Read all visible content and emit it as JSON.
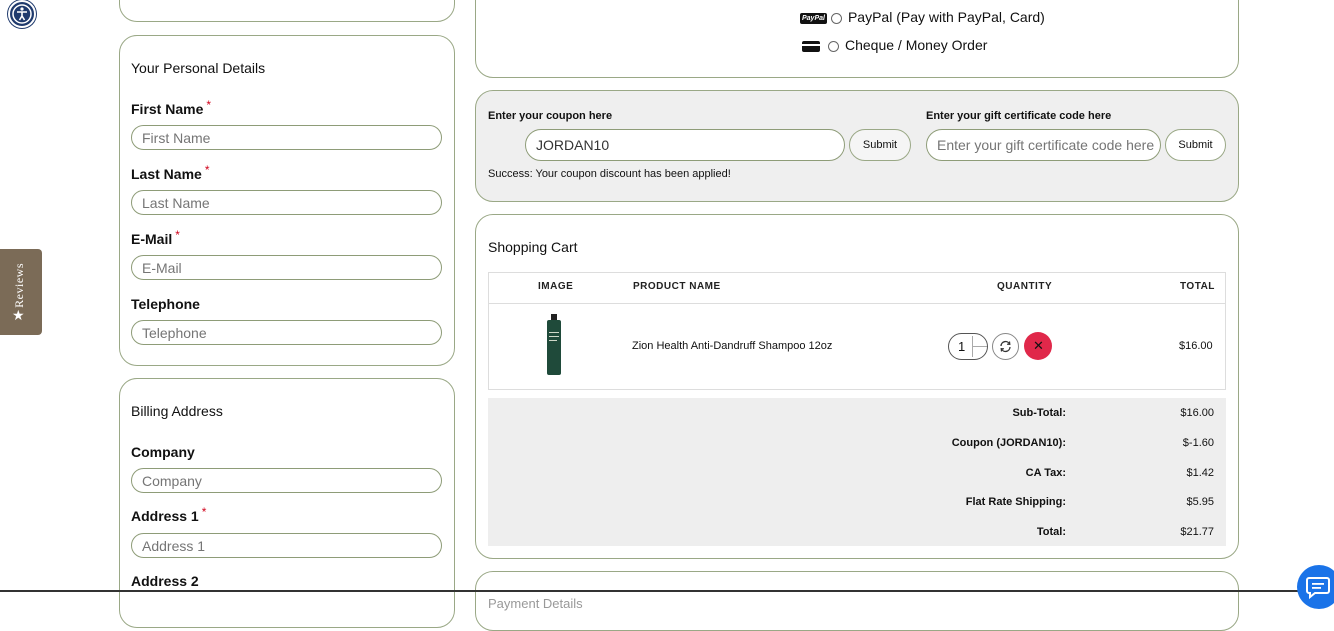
{
  "accessibility": {
    "icon": "accessibility-icon"
  },
  "reviews_tab": {
    "label": "Reviews",
    "icon": "star-icon"
  },
  "personal": {
    "title": "Your Personal Details",
    "fields": [
      {
        "label": "First Name",
        "placeholder": "First Name",
        "required": "*"
      },
      {
        "label": "Last Name",
        "placeholder": "Last Name",
        "required": "*"
      },
      {
        "label": "E-Mail",
        "placeholder": "E-Mail",
        "required": "*"
      },
      {
        "label": "Telephone",
        "placeholder": "Telephone"
      }
    ]
  },
  "billing": {
    "title": "Billing Address",
    "fields": [
      {
        "label": "Company",
        "placeholder": "Company"
      },
      {
        "label": "Address 1",
        "placeholder": "Address 1",
        "required": "*"
      },
      {
        "label": "Address 2"
      }
    ]
  },
  "payment": {
    "options": [
      {
        "label": "PayPal (Pay with PayPal, Card)",
        "badge": "PayPal",
        "icon": "paypal-icon"
      },
      {
        "label": "Cheque / Money Order",
        "icon": "card-icon"
      }
    ]
  },
  "coupon": {
    "label": "Enter your coupon here",
    "value": "JORDAN10",
    "submit": "Submit",
    "success": "Success: Your coupon discount has been applied!"
  },
  "gift": {
    "label": "Enter your gift certificate code here",
    "placeholder": "Enter your gift certificate code here",
    "submit": "Submit"
  },
  "cart": {
    "title": "Shopping Cart",
    "headers": {
      "image": "IMAGE",
      "product": "PRODUCT NAME",
      "quantity": "QUANTITY",
      "total": "TOTAL"
    },
    "item": {
      "name": "Zion Health Anti-Dandruff Shampoo 12oz",
      "quantity": "1",
      "total": "$16.00"
    },
    "totals": [
      {
        "label": "Sub-Total:",
        "value": "$16.00"
      },
      {
        "label": "Coupon (JORDAN10):",
        "value": "$-1.60"
      },
      {
        "label": "CA Tax:",
        "value": "$1.42"
      },
      {
        "label": "Flat Rate Shipping:",
        "value": "$5.95"
      },
      {
        "label": "Total:",
        "value": "$21.77"
      }
    ]
  },
  "next_section": {
    "title": "Payment Details"
  },
  "colors": {
    "panel_border": "#9aa886",
    "coupon_bg": "#efefef",
    "remove": "#e0284a",
    "reviews": "#7b6b57"
  }
}
